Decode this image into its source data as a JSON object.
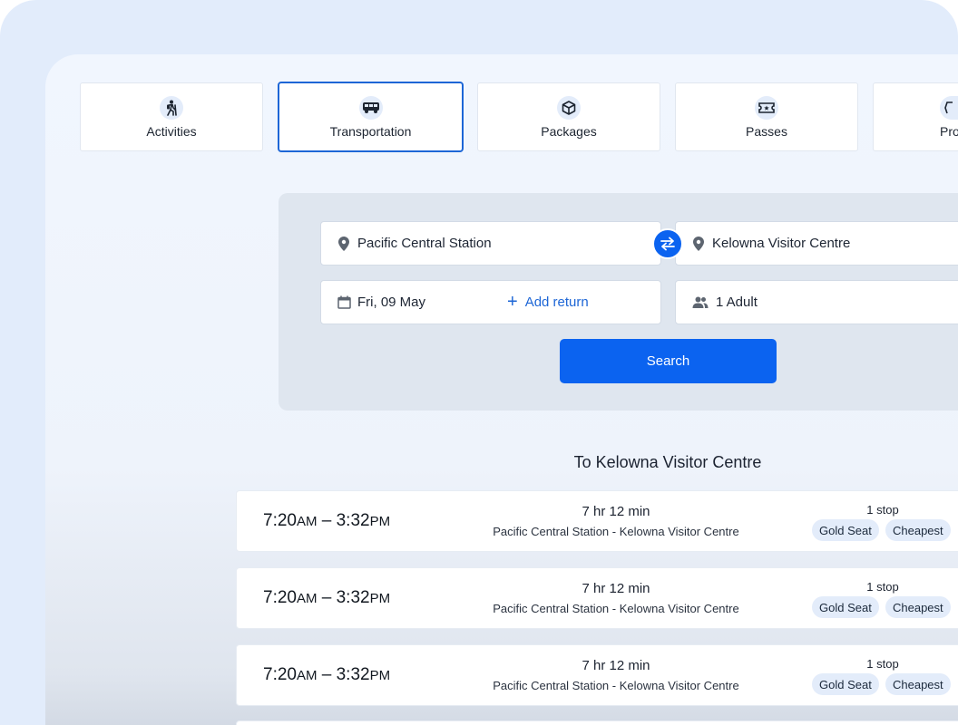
{
  "tabs": [
    {
      "label": "Activities",
      "icon": "hiking-icon",
      "active": false
    },
    {
      "label": "Transportation",
      "icon": "bus-icon",
      "active": true
    },
    {
      "label": "Packages",
      "icon": "package-icon",
      "active": false
    },
    {
      "label": "Passes",
      "icon": "ticket-icon",
      "active": false
    },
    {
      "label": "Pro",
      "icon": "tag-icon",
      "active": false
    }
  ],
  "search": {
    "from": "Pacific Central Station",
    "to": "Kelowna Visitor Centre",
    "date": "Fri, 09 May",
    "add_return": "Add return",
    "passengers": "1 Adult",
    "search_label": "Search"
  },
  "results": {
    "title": "To Kelowna Visitor Centre",
    "rows": [
      {
        "depart": "7:20",
        "depart_ampm": "AM",
        "arrive": "3:32",
        "arrive_ampm": "PM",
        "duration": "7 hr 12 min",
        "route": "Pacific Central Station  - Kelowna Visitor Centre",
        "stops": "1 stop",
        "badges": [
          "Gold Seat",
          "Cheapest"
        ]
      },
      {
        "depart": "7:20",
        "depart_ampm": "AM",
        "arrive": "3:32",
        "arrive_ampm": "PM",
        "duration": "7 hr 12 min",
        "route": "Pacific Central Station  - Kelowna Visitor Centre",
        "stops": "1 stop",
        "badges": [
          "Gold Seat",
          "Cheapest"
        ]
      },
      {
        "depart": "7:20",
        "depart_ampm": "AM",
        "arrive": "3:32",
        "arrive_ampm": "PM",
        "duration": "7 hr 12 min",
        "route": "Pacific Central Station  - Kelowna Visitor Centre",
        "stops": "1 stop",
        "badges": [
          "Gold Seat",
          "Cheapest"
        ]
      }
    ]
  },
  "colors": {
    "accent": "#0b63f0",
    "active_border": "#1d66d6",
    "badge_bg": "#e3ecfa"
  }
}
